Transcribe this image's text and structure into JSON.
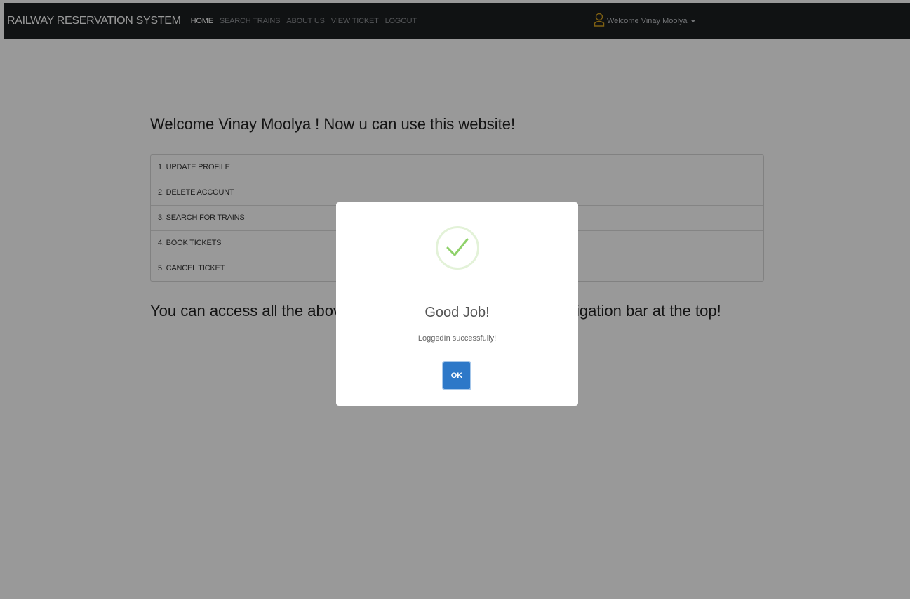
{
  "navbar": {
    "brand": "RAILWAY RESERVATION SYSTEM",
    "links": [
      "HOME",
      "SEARCH TRAINS",
      "ABOUT US",
      "VIEW TICKET",
      "LOGOUT"
    ],
    "user_label": "Welcome Vinay Moolya",
    "user_icon": "user-icon"
  },
  "main": {
    "heading": "Welcome Vinay Moolya ! Now u can use this website!",
    "menu_items": [
      "1. UPDATE PROFILE",
      "2. DELETE ACCOUNT",
      "3. SEARCH FOR TRAINS",
      "4. BOOK TICKETS",
      "5. CANCEL TICKET"
    ],
    "access_text": "You can access all the above mentioned features from the navigation bar at the top!"
  },
  "modal": {
    "icon": "success-check-icon",
    "title": "Good Job!",
    "text": "LoggedIn successfully!",
    "ok_label": "OK"
  },
  "colors": {
    "navbar_bg": "#1c1e20",
    "overlay": "rgba(0,0,0,0.4)",
    "ok_button": "#2d78c8",
    "success_green": "#8fd16a"
  }
}
